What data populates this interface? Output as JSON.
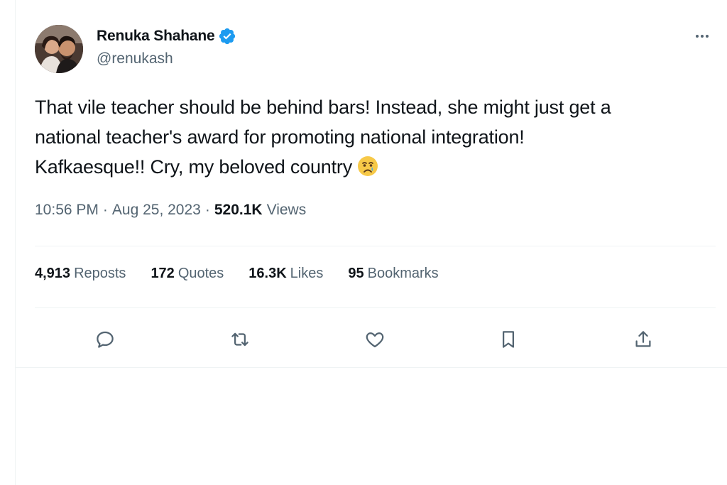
{
  "author": {
    "display_name": "Renuka Shahane",
    "handle": "@renukash",
    "verified": true
  },
  "tweet": {
    "text": "That vile teacher should be behind bars! Instead, she might just get a\nnational teacher's award for promoting national integration!\nKafkaesque!! Cry, my beloved country",
    "emoji": "crying-face"
  },
  "meta": {
    "time": "10:56 PM",
    "separator": "·",
    "date": "Aug 25, 2023",
    "views_count": "520.1K",
    "views_label": "Views"
  },
  "stats": {
    "reposts_count": "4,913",
    "reposts_label": "Reposts",
    "quotes_count": "172",
    "quotes_label": "Quotes",
    "likes_count": "16.3K",
    "likes_label": "Likes",
    "bookmarks_count": "95",
    "bookmarks_label": "Bookmarks"
  },
  "actions": [
    "reply-icon",
    "repost-icon",
    "like-icon",
    "bookmark-icon",
    "share-icon"
  ],
  "colors": {
    "verified": "#1d9bf0",
    "secondary_text": "#536471",
    "primary_text": "#0f1419",
    "divider": "#eff3f4"
  }
}
